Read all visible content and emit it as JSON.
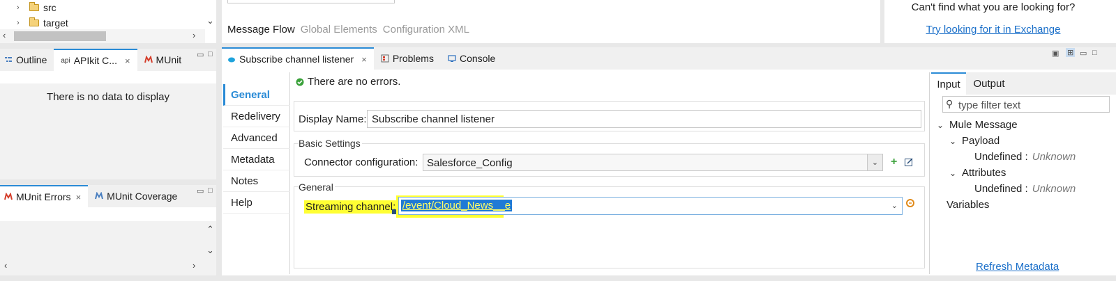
{
  "project_tree": {
    "items": [
      {
        "label": "src"
      },
      {
        "label": "target"
      }
    ]
  },
  "outline_tabs": [
    {
      "label": "Outline"
    },
    {
      "label": "APIkit C...",
      "prefix": "api"
    },
    {
      "label": "MUnit"
    }
  ],
  "outline_panel": {
    "empty_text": "There is no data to display"
  },
  "munit_tabs": [
    {
      "label": "MUnit Errors"
    },
    {
      "label": "MUnit Coverage"
    }
  ],
  "editor": {
    "tabs": [
      {
        "label": "Message Flow"
      },
      {
        "label": "Global Elements"
      },
      {
        "label": "Configuration XML"
      }
    ]
  },
  "exchange": {
    "prompt": "Can't find what you are looking for?",
    "link": "Try looking for it in Exchange"
  },
  "bottom_tabs": [
    {
      "label": "Subscribe channel listener"
    },
    {
      "label": "Problems"
    },
    {
      "label": "Console"
    }
  ],
  "properties": {
    "nav": [
      {
        "label": "General"
      },
      {
        "label": "Redelivery"
      },
      {
        "label": "Advanced"
      },
      {
        "label": "Metadata"
      },
      {
        "label": "Notes"
      },
      {
        "label": "Help"
      }
    ],
    "status": "There are no errors.",
    "display_name_label": "Display Name:",
    "display_name_value": "Subscribe channel listener",
    "basic_settings_title": "Basic Settings",
    "connector_label": "Connector configuration:",
    "connector_value": "Salesforce_Config",
    "general_title": "General",
    "streaming_label": "Streaming channel:",
    "streaming_value": "/event/Cloud_News__e"
  },
  "metadata": {
    "tabs": [
      {
        "label": "Input"
      },
      {
        "label": "Output"
      }
    ],
    "filter_placeholder": "type filter text",
    "tree": {
      "root": "Mule Message",
      "payload": "Payload",
      "payload_value": "Undefined :",
      "payload_type": "Unknown",
      "attributes": "Attributes",
      "attributes_value": "Undefined :",
      "attributes_type": "Unknown",
      "variables": "Variables"
    },
    "refresh": "Refresh Metadata"
  },
  "colors": {
    "accent": "#2a8bd6",
    "highlight": "#ffff33",
    "selection": "#1f7ad6",
    "link": "#1a6fc9"
  }
}
